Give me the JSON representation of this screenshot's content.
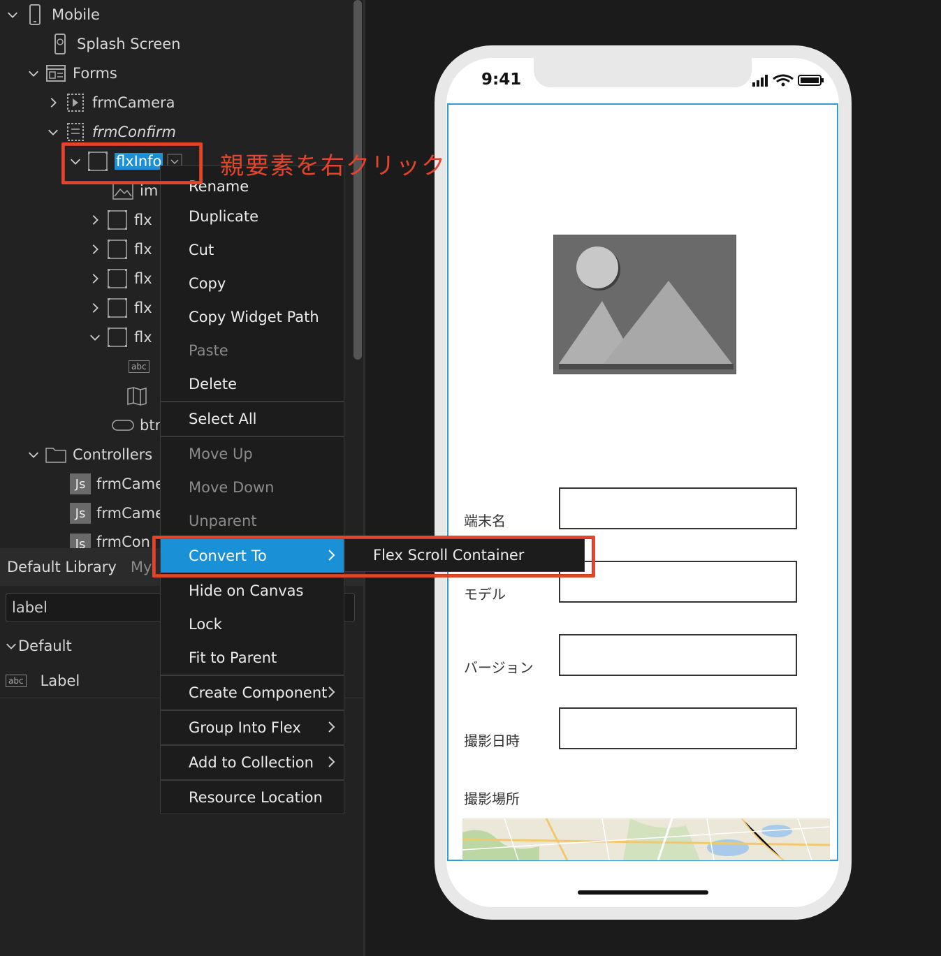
{
  "tree": {
    "mobile": "Mobile",
    "splash": "Splash Screen",
    "forms": "Forms",
    "frm_camera": "frmCamera",
    "frm_confirm": "frmConfirm",
    "flx_info": "flxInfo",
    "child_img": "im",
    "child_flx": "flx",
    "child_btn": "btn",
    "controllers": "Controllers",
    "ctrl_1": "frmCame",
    "ctrl_2": "frmCame",
    "ctrl_3": "frmCon",
    "js_badge": "Js",
    "abc_badge": "abc"
  },
  "annotation": {
    "text": "親要素を右クリック",
    "color": "#e2442c"
  },
  "context_menu": {
    "items": [
      {
        "label": "Rename",
        "enabled": true
      },
      {
        "label": "Duplicate",
        "enabled": true
      },
      {
        "label": "Cut",
        "enabled": true
      },
      {
        "label": "Copy",
        "enabled": true
      },
      {
        "label": "Copy Widget Path",
        "enabled": true
      },
      {
        "label": "Paste",
        "enabled": false
      },
      {
        "label": "Delete",
        "enabled": true
      },
      {
        "label": "Select All",
        "enabled": true
      },
      {
        "label": "Move Up",
        "enabled": false
      },
      {
        "label": "Move Down",
        "enabled": false
      },
      {
        "label": "Unparent",
        "enabled": false
      },
      {
        "label": "Convert To",
        "enabled": true,
        "active": true
      },
      {
        "label": "Hide on Canvas",
        "enabled": true
      },
      {
        "label": "Lock",
        "enabled": true
      },
      {
        "label": "Fit to Parent",
        "enabled": true
      },
      {
        "label": "Create Component",
        "enabled": true
      },
      {
        "label": "Group Into Flex",
        "enabled": true
      },
      {
        "label": "Add to Collection",
        "enabled": true
      },
      {
        "label": "Resource Location",
        "enabled": true
      }
    ],
    "submenu": {
      "label": "Flex Scroll Container"
    }
  },
  "library": {
    "tab_default": "Default Library",
    "tab_my": "My",
    "search_value": "label",
    "group": "Default",
    "item": "Label",
    "abc_badge": "abc"
  },
  "phone": {
    "time": "9:41",
    "fields": [
      {
        "label": "端末名"
      },
      {
        "label": "モデル"
      },
      {
        "label": "バージョン"
      },
      {
        "label": "撮影日時"
      }
    ],
    "location_label": "撮影場所"
  },
  "colors": {
    "selection": "#1a91d6",
    "annotation": "#e2442c",
    "frame": "#2e9bdb"
  }
}
